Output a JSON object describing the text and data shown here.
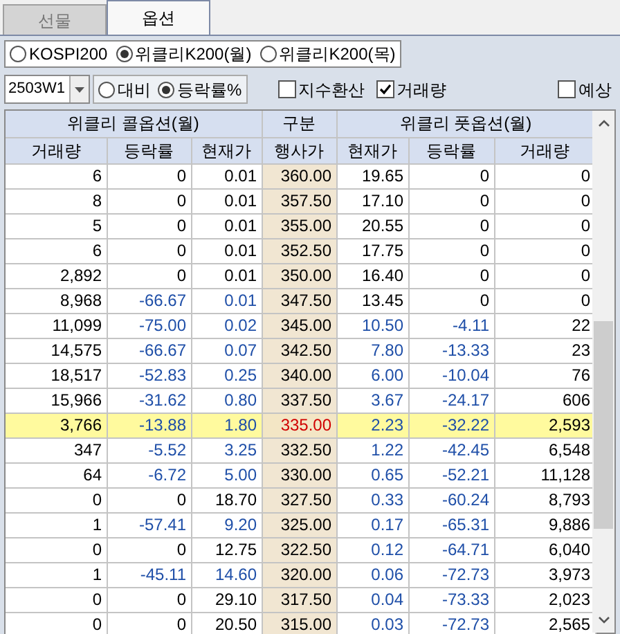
{
  "tabs": [
    {
      "label": "선물",
      "selected": false
    },
    {
      "label": "옵션",
      "selected": true
    }
  ],
  "underlyings": [
    {
      "label": "KOSPI200",
      "selected": false
    },
    {
      "label": "위클리K200(월)",
      "selected": true
    },
    {
      "label": "위클리K200(목)",
      "selected": false
    }
  ],
  "expiry": {
    "value": "2503W1"
  },
  "display_modes": [
    {
      "label": "대비",
      "selected": false
    },
    {
      "label": "등락률%",
      "selected": true
    }
  ],
  "options": [
    {
      "label": "지수환산",
      "checked": false
    },
    {
      "label": "거래량",
      "checked": true
    }
  ],
  "expected": {
    "label": "예상",
    "checked": false
  },
  "table": {
    "groups": [
      "위클리 콜옵션(월)",
      "구분",
      "위클리 풋옵션(월)"
    ],
    "columns": [
      "거래량",
      "등락률",
      "현재가",
      "행사가",
      "현재가",
      "등락률",
      "거래량"
    ],
    "rows": [
      {
        "call_volume": "6",
        "call_rate": "0",
        "call_price": "0.01",
        "call_down": false,
        "strike": "360.00",
        "put_price": "19.65",
        "put_rate": "0",
        "put_volume": "0",
        "put_down": false,
        "highlighted": false
      },
      {
        "call_volume": "8",
        "call_rate": "0",
        "call_price": "0.01",
        "call_down": false,
        "strike": "357.50",
        "put_price": "17.10",
        "put_rate": "0",
        "put_volume": "0",
        "put_down": false,
        "highlighted": false
      },
      {
        "call_volume": "5",
        "call_rate": "0",
        "call_price": "0.01",
        "call_down": false,
        "strike": "355.00",
        "put_price": "20.55",
        "put_rate": "0",
        "put_volume": "0",
        "put_down": false,
        "highlighted": false
      },
      {
        "call_volume": "6",
        "call_rate": "0",
        "call_price": "0.01",
        "call_down": false,
        "strike": "352.50",
        "put_price": "17.75",
        "put_rate": "0",
        "put_volume": "0",
        "put_down": false,
        "highlighted": false
      },
      {
        "call_volume": "2,892",
        "call_rate": "0",
        "call_price": "0.01",
        "call_down": false,
        "strike": "350.00",
        "put_price": "16.40",
        "put_rate": "0",
        "put_volume": "0",
        "put_down": false,
        "highlighted": false
      },
      {
        "call_volume": "8,968",
        "call_rate": "-66.67",
        "call_price": "0.01",
        "call_down": true,
        "strike": "347.50",
        "put_price": "13.45",
        "put_rate": "0",
        "put_volume": "0",
        "put_down": false,
        "highlighted": false
      },
      {
        "call_volume": "11,099",
        "call_rate": "-75.00",
        "call_price": "0.02",
        "call_down": true,
        "strike": "345.00",
        "put_price": "10.50",
        "put_rate": "-4.11",
        "put_volume": "22",
        "put_down": true,
        "highlighted": false
      },
      {
        "call_volume": "14,575",
        "call_rate": "-66.67",
        "call_price": "0.07",
        "call_down": true,
        "strike": "342.50",
        "put_price": "7.80",
        "put_rate": "-13.33",
        "put_volume": "23",
        "put_down": true,
        "highlighted": false
      },
      {
        "call_volume": "18,517",
        "call_rate": "-52.83",
        "call_price": "0.25",
        "call_down": true,
        "strike": "340.00",
        "put_price": "6.00",
        "put_rate": "-10.04",
        "put_volume": "76",
        "put_down": true,
        "highlighted": false
      },
      {
        "call_volume": "15,966",
        "call_rate": "-31.62",
        "call_price": "0.80",
        "call_down": true,
        "strike": "337.50",
        "put_price": "3.67",
        "put_rate": "-24.17",
        "put_volume": "606",
        "put_down": true,
        "highlighted": false
      },
      {
        "call_volume": "3,766",
        "call_rate": "-13.88",
        "call_price": "1.80",
        "call_down": true,
        "strike": "335.00",
        "put_price": "2.23",
        "put_rate": "-32.22",
        "put_volume": "2,593",
        "put_down": true,
        "highlighted": true
      },
      {
        "call_volume": "347",
        "call_rate": "-5.52",
        "call_price": "3.25",
        "call_down": true,
        "strike": "332.50",
        "put_price": "1.22",
        "put_rate": "-42.45",
        "put_volume": "6,548",
        "put_down": true,
        "highlighted": false
      },
      {
        "call_volume": "64",
        "call_rate": "-6.72",
        "call_price": "5.00",
        "call_down": true,
        "strike": "330.00",
        "put_price": "0.65",
        "put_rate": "-52.21",
        "put_volume": "11,128",
        "put_down": true,
        "highlighted": false
      },
      {
        "call_volume": "0",
        "call_rate": "0",
        "call_price": "18.70",
        "call_down": false,
        "strike": "327.50",
        "put_price": "0.33",
        "put_rate": "-60.24",
        "put_volume": "8,793",
        "put_down": true,
        "highlighted": false
      },
      {
        "call_volume": "1",
        "call_rate": "-57.41",
        "call_price": "9.20",
        "call_down": true,
        "strike": "325.00",
        "put_price": "0.17",
        "put_rate": "-65.31",
        "put_volume": "9,886",
        "put_down": true,
        "highlighted": false
      },
      {
        "call_volume": "0",
        "call_rate": "0",
        "call_price": "12.75",
        "call_down": false,
        "strike": "322.50",
        "put_price": "0.12",
        "put_rate": "-64.71",
        "put_volume": "6,040",
        "put_down": true,
        "highlighted": false
      },
      {
        "call_volume": "1",
        "call_rate": "-45.11",
        "call_price": "14.60",
        "call_down": true,
        "strike": "320.00",
        "put_price": "0.06",
        "put_rate": "-72.73",
        "put_volume": "3,973",
        "put_down": true,
        "highlighted": false
      },
      {
        "call_volume": "0",
        "call_rate": "0",
        "call_price": "29.10",
        "call_down": false,
        "strike": "317.50",
        "put_price": "0.04",
        "put_rate": "-73.33",
        "put_volume": "2,023",
        "put_down": true,
        "highlighted": false
      },
      {
        "call_volume": "0",
        "call_rate": "0",
        "call_price": "20.50",
        "call_down": false,
        "strike": "315.00",
        "put_price": "0.03",
        "put_rate": "-72.73",
        "put_volume": "2,565",
        "put_down": true,
        "highlighted": false
      }
    ]
  }
}
